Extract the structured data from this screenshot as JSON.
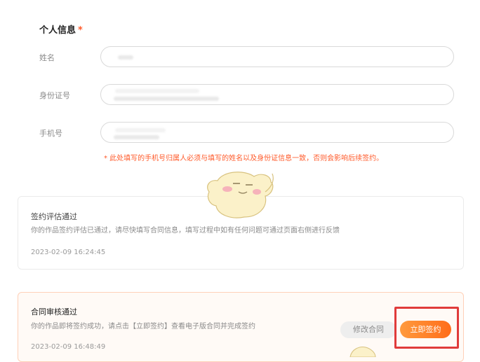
{
  "form": {
    "section_title": "个人信息",
    "required_mark": "*",
    "fields": [
      {
        "label": "姓名"
      },
      {
        "label": "身份证号"
      },
      {
        "label": "手机号"
      }
    ],
    "warning": "* 此处填写的手机号归属人必须与填写的姓名以及身份证信息一致，否则会影响后续签约。"
  },
  "status_cards": [
    {
      "title": "签约评估通过",
      "description": "你的作品签约评估已通过，请尽快填写合同信息，填写过程中如有任何问题可通过页面右侧进行反馈",
      "timestamp": "2023-02-09 16:24:45"
    },
    {
      "title": "合同审核通过",
      "description": "你的作品即将签约成功，请点击【立即签约】查看电子版合同并完成签约",
      "timestamp": "2023-02-09 16:48:49"
    }
  ],
  "actions": {
    "modify_label": "修改合同",
    "sign_label": "立即签约"
  },
  "colors": {
    "accent": "#ff6d1a",
    "warning": "#ff5a2a",
    "highlight": "#e03b3b"
  },
  "icons": [
    "mascot-icon"
  ]
}
